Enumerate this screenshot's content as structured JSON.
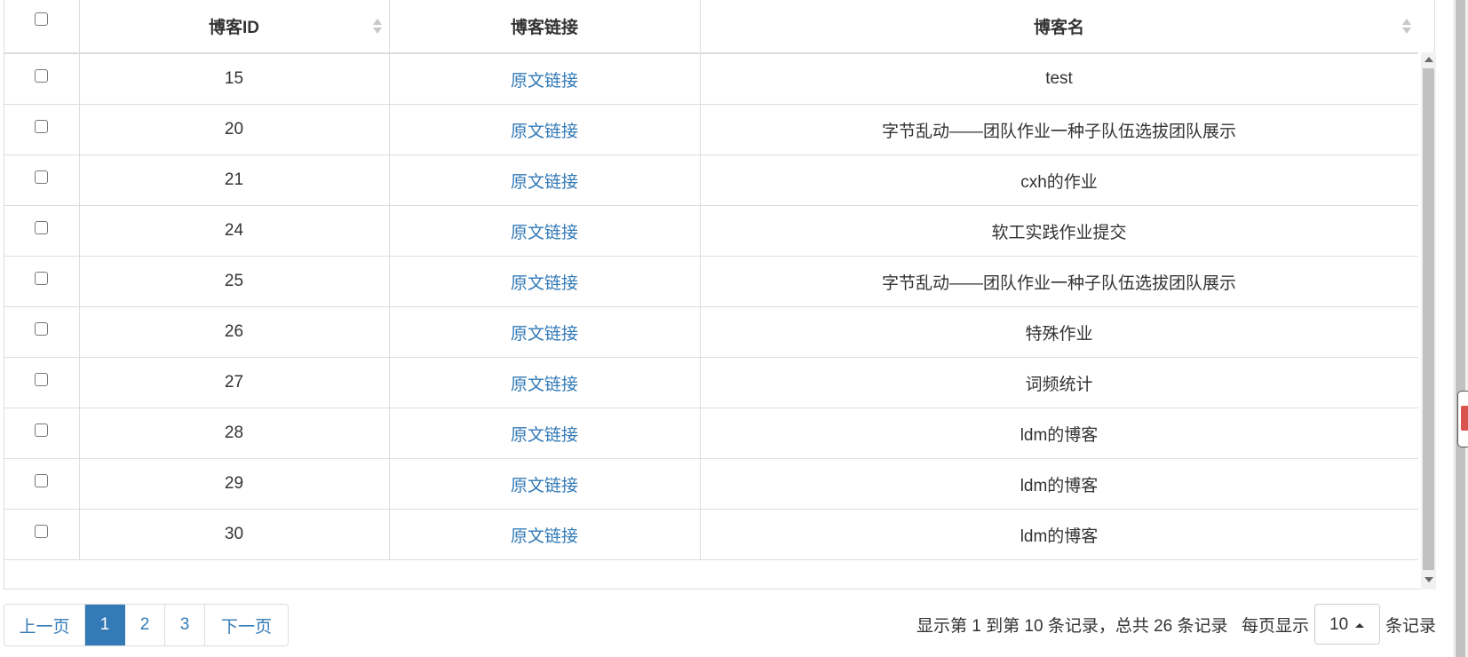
{
  "table": {
    "headers": {
      "id": "博客ID",
      "link": "博客链接",
      "name": "博客名"
    },
    "link_text": "原文链接",
    "rows": [
      {
        "id": "15",
        "name": "test"
      },
      {
        "id": "20",
        "name": "字节乱动——团队作业一种子队伍选拔团队展示"
      },
      {
        "id": "21",
        "name": "cxh的作业"
      },
      {
        "id": "24",
        "name": "软工实践作业提交"
      },
      {
        "id": "25",
        "name": "字节乱动——团队作业一种子队伍选拔团队展示"
      },
      {
        "id": "26",
        "name": "特殊作业"
      },
      {
        "id": "27",
        "name": "词频统计"
      },
      {
        "id": "28",
        "name": "ldm的博客"
      },
      {
        "id": "29",
        "name": "ldm的博客"
      },
      {
        "id": "30",
        "name": "ldm的博客"
      }
    ]
  },
  "pagination": {
    "prev": "上一页",
    "pages": [
      "1",
      "2",
      "3"
    ],
    "active_page": "1",
    "next": "下一页"
  },
  "footer": {
    "info": "显示第 1 到第 10 条记录，总共 26 条记录",
    "per_page_label": "每页显示",
    "page_size": "10",
    "records_label": "条记录"
  },
  "colors": {
    "link": "#337ab7",
    "active_page_bg": "#337ab7",
    "border": "#dddddd"
  },
  "icons": {
    "sort": "sort-both-icon",
    "page_size_caret": "caret-up-icon"
  }
}
